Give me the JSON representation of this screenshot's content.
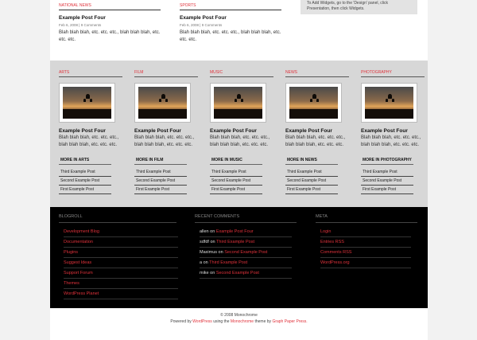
{
  "top": {
    "columns": [
      {
        "label": "NATIONAL NEWS",
        "title": "Example Post Four",
        "meta": "Feb 6, 2008 | 9 Comments",
        "excerpt": "Blah blah blah, etc. etc. etc., blah blah blah, etc. etc. etc."
      },
      {
        "label": "SPORTS",
        "title": "Example Post Four",
        "meta": "Feb 6, 2008 | 9 Comments",
        "excerpt": "Blah blah blah, etc. etc. etc., blah blah blah, etc. etc. etc."
      }
    ],
    "widget_text": "To Add Widgets, go to the 'Design' panel, click Presentation, then click Widgets."
  },
  "grey": {
    "columns": [
      {
        "label": "ARTS",
        "title": "Example Post Four",
        "excerpt": "Blah blah blah, etc. etc. etc., blah blah blah, etc. etc. etc.",
        "more": "MORE IN ARTS",
        "posts": [
          "Third Example Post",
          "Second Example Post",
          "First Example Post"
        ]
      },
      {
        "label": "FILM",
        "title": "Example Post Four",
        "excerpt": "Blah blah blah, etc. etc. etc., blah blah blah, etc. etc. etc.",
        "more": "MORE IN FILM",
        "posts": [
          "Third Example Post",
          "Second Example Post",
          "First Example Post"
        ]
      },
      {
        "label": "MUSIC",
        "title": "Example Post Four",
        "excerpt": "Blah blah blah, etc. etc. etc., blah blah blah, etc. etc. etc.",
        "more": "MORE IN MUSIC",
        "posts": [
          "Third Example Post",
          "Second Example Post",
          "First Example Post"
        ]
      },
      {
        "label": "NEWS",
        "title": "Example Post Four",
        "excerpt": "Blah blah blah, etc. etc. etc., blah blah blah, etc. etc. etc.",
        "more": "MORE IN NEWS",
        "posts": [
          "Third Example Post",
          "Second Example Post",
          "First Example Post"
        ]
      },
      {
        "label": "PHOTOGRAPHY",
        "title": "Example Post Four",
        "excerpt": "Blah blah blah, etc. etc. etc., blah blah blah, etc. etc. etc.",
        "more": "MORE IN PHOTOGRAPHY",
        "posts": [
          "Third Example Post",
          "Second Example Post",
          "First Example Post"
        ]
      }
    ]
  },
  "footer_widgets": {
    "blogroll": {
      "label": "BLOGROLL",
      "items": [
        "Development Blog",
        "Documentation",
        "Plugins",
        "Suggest Ideas",
        "Support Forum",
        "Themes",
        "WordPress Planet"
      ]
    },
    "recent_comments": {
      "label": "RECENT COMMENTS",
      "items": [
        {
          "author": "allen",
          "on": "on",
          "post": "Example Post Four"
        },
        {
          "author": "sdfdf",
          "on": "on",
          "post": "Third Example Post"
        },
        {
          "author": "Maximus",
          "on": "on",
          "post": "Second Example Post"
        },
        {
          "author": "a",
          "on": "on",
          "post": "Third Example Post"
        },
        {
          "author": "mike",
          "on": "on",
          "post": "Second Example Post"
        }
      ]
    },
    "meta": {
      "label": "META",
      "items": [
        "Login",
        "Entries RSS",
        "Comments RSS",
        "WordPress.org"
      ]
    }
  },
  "footer": {
    "copyright": "© 2008 Monochrome",
    "powered_prefix": "Powered by",
    "wordpress": "WordPress",
    "using": "using the",
    "theme": "Monochrome",
    "theme_by": "theme by",
    "author": "Graph Paper Press."
  },
  "colors": {
    "accent": "#e0323b",
    "grey_band": "#d7d7d7",
    "footer_band": "#000000"
  }
}
